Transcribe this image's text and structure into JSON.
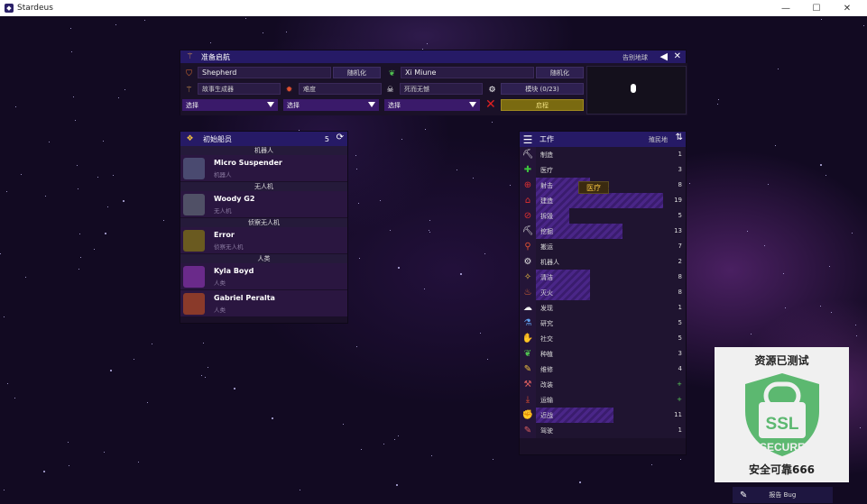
{
  "window": {
    "title": "Stardeus",
    "controls": [
      "minimize",
      "maximize",
      "close"
    ]
  },
  "prep": {
    "title": "准备启航",
    "map_label": "告别地球",
    "captain": "Shepherd",
    "ai_name": "Xi Miune",
    "randomize": "随机化",
    "story": "故事生成器",
    "difficulty": "难度",
    "death": "死而无憾",
    "mods": "模块 (0/23)",
    "select": "选择",
    "start": "启程"
  },
  "crew": {
    "title": "初始船员",
    "count": "5",
    "groups": [
      {
        "label": "机器人",
        "members": [
          {
            "name": "Micro Suspender",
            "type": "机器人"
          }
        ]
      },
      {
        "label": "无人机",
        "members": [
          {
            "name": "Woody G2",
            "type": "无人机"
          }
        ]
      },
      {
        "label": "侦察无人机",
        "members": [
          {
            "name": "Error",
            "type": "侦察无人机"
          }
        ]
      },
      {
        "label": "人类",
        "members": [
          {
            "name": "Kyla Boyd",
            "type": "人类"
          },
          {
            "name": "Gabriel Peralta",
            "type": "人类"
          }
        ]
      }
    ]
  },
  "jobs": {
    "title": "工作",
    "colonist_label": "殖民地",
    "tooltip": "医疗",
    "items": [
      {
        "icon": "pickaxe-icon",
        "glyph": "⛏",
        "color": "#e0e0e0",
        "name": "制造",
        "count": "1",
        "fill": 0
      },
      {
        "icon": "medical-cross-icon",
        "glyph": "✚",
        "color": "#3ec43e",
        "name": "医疗",
        "count": "3",
        "fill": 0
      },
      {
        "icon": "crosshair-icon",
        "glyph": "⊕",
        "color": "#e03030",
        "name": "射击",
        "count": "8",
        "fill": 0.36
      },
      {
        "icon": "build-icon",
        "glyph": "⌂",
        "color": "#e03030",
        "name": "建造",
        "count": "19",
        "fill": 0.85
      },
      {
        "icon": "prohibit-icon",
        "glyph": "⊘",
        "color": "#e03030",
        "name": "拆毁",
        "count": "5",
        "fill": 0.22
      },
      {
        "icon": "mine-icon",
        "glyph": "⛏",
        "color": "#e0e0e0",
        "name": "挖掘",
        "count": "13",
        "fill": 0.58
      },
      {
        "icon": "pin-icon",
        "glyph": "⚲",
        "color": "#e05030",
        "name": "搬运",
        "count": "7",
        "fill": 0
      },
      {
        "icon": "gear-icon",
        "glyph": "⚙",
        "color": "#e0e0e0",
        "name": "机器人",
        "count": "2",
        "fill": 0
      },
      {
        "icon": "sparkle-icon",
        "glyph": "✧",
        "color": "#f0c040",
        "name": "清洁",
        "count": "8",
        "fill": 0.36
      },
      {
        "icon": "fire-icon",
        "glyph": "♨",
        "color": "#f07030",
        "name": "灭火",
        "count": "8",
        "fill": 0.36
      },
      {
        "icon": "explosion-icon",
        "glyph": "☁",
        "color": "#f0f0f0",
        "name": "发现",
        "count": "1",
        "fill": 0
      },
      {
        "icon": "flask-icon",
        "glyph": "⚗",
        "color": "#60a0f0",
        "name": "研究",
        "count": "5",
        "fill": 0
      },
      {
        "icon": "handshake-icon",
        "glyph": "✋",
        "color": "#f0a030",
        "name": "社交",
        "count": "5",
        "fill": 0
      },
      {
        "icon": "leaf-icon",
        "glyph": "❦",
        "color": "#50c050",
        "name": "种植",
        "count": "3",
        "fill": 0
      },
      {
        "icon": "wrench-icon",
        "glyph": "✎",
        "color": "#f0c040",
        "name": "维修",
        "count": "4",
        "fill": 0
      },
      {
        "icon": "tool-icon",
        "glyph": "⚒",
        "color": "#e06060",
        "name": "改装",
        "count": "+",
        "fill": 0
      },
      {
        "icon": "download-icon",
        "glyph": "⤓",
        "color": "#e05030",
        "name": "运输",
        "count": "+",
        "fill": 0
      },
      {
        "icon": "fist-icon",
        "glyph": "✊",
        "color": "#f0b030",
        "name": "近战",
        "count": "11",
        "fill": 0.52
      },
      {
        "icon": "syringe-icon",
        "glyph": "✎",
        "color": "#e06060",
        "name": "驾驶",
        "count": "1",
        "fill": 0
      }
    ]
  },
  "ssl": {
    "top": "资源已测试",
    "line1": "SSL",
    "line2": "SECURE",
    "bottom": "安全可靠666",
    "color": "#5cb870"
  },
  "report": {
    "label": "报告 Bug"
  }
}
